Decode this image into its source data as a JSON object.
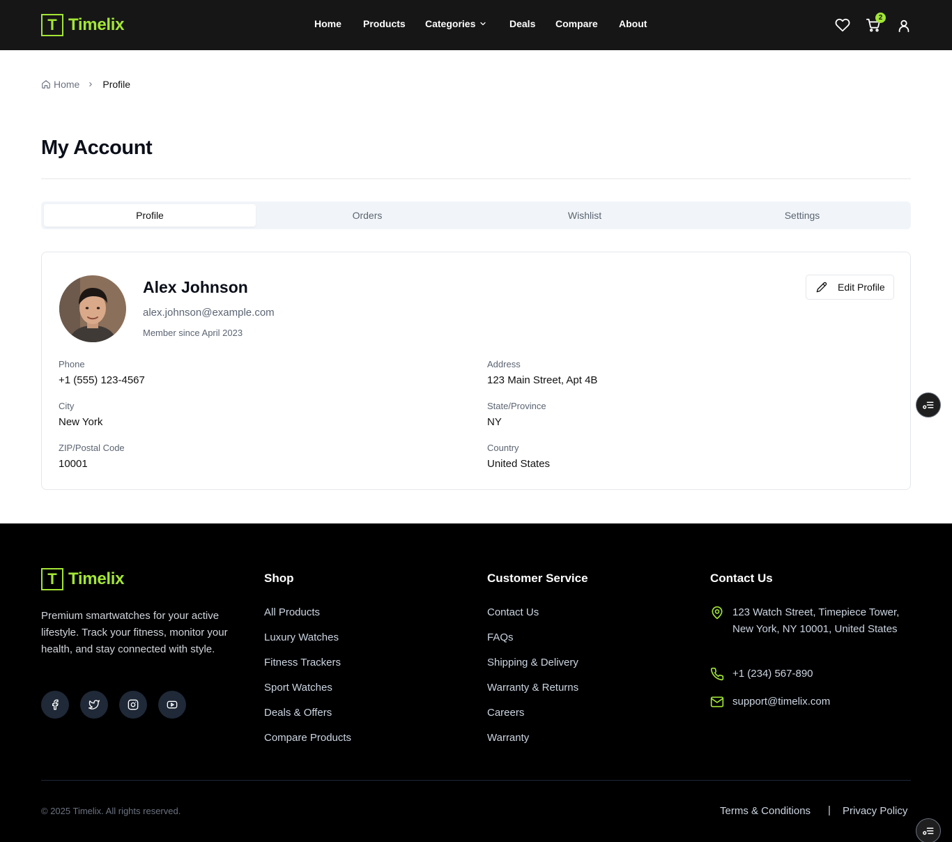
{
  "brand": {
    "mark": "T",
    "name": "Timelix",
    "accent": "#a3e635"
  },
  "nav": [
    {
      "label": "Home"
    },
    {
      "label": "Products"
    },
    {
      "label": "Categories"
    },
    {
      "label": "Deals"
    },
    {
      "label": "Compare"
    },
    {
      "label": "About"
    }
  ],
  "header_icons": {
    "wishlist": "heart-icon",
    "cart": "cart-icon",
    "account": "user-icon",
    "cart_count": "2"
  },
  "breadcrumb": {
    "home": "Home",
    "current": "Profile"
  },
  "page_title": "My Account",
  "tabs": [
    {
      "label": "Profile",
      "active": true
    },
    {
      "label": "Orders",
      "active": false
    },
    {
      "label": "Wishlist",
      "active": false
    },
    {
      "label": "Settings",
      "active": false
    }
  ],
  "profile": {
    "name": "Alex Johnson",
    "email": "alex.johnson@example.com",
    "member_since": "Member since April 2023",
    "edit_label": "Edit Profile",
    "fields": {
      "phone": {
        "label": "Phone",
        "value": "+1 (555) 123-4567"
      },
      "address": {
        "label": "Address",
        "value": "123 Main Street, Apt 4B"
      },
      "city": {
        "label": "City",
        "value": "New York"
      },
      "state": {
        "label": "State/Province",
        "value": "NY"
      },
      "zip": {
        "label": "ZIP/Postal Code",
        "value": "10001"
      },
      "country": {
        "label": "Country",
        "value": "United States"
      }
    }
  },
  "footer": {
    "description": "Premium smartwatches for your active lifestyle. Track your fitness, monitor your health, and stay connected with style.",
    "social": [
      "facebook-icon",
      "twitter-icon",
      "instagram-icon",
      "youtube-icon"
    ],
    "shop": {
      "heading": "Shop",
      "links": [
        "All Products",
        "Luxury Watches",
        "Fitness Trackers",
        "Sport Watches",
        "Deals & Offers",
        "Compare Products"
      ]
    },
    "service": {
      "heading": "Customer Service",
      "links": [
        "Contact Us",
        "FAQs",
        "Shipping & Delivery",
        "Warranty & Returns",
        "Careers",
        "Warranty"
      ]
    },
    "contact": {
      "heading": "Contact Us",
      "address": "123 Watch Street, Timepiece Tower, New York, NY 10001, United States",
      "phone": "+1 (234) 567-890",
      "email": "support@timelix.com"
    },
    "copyright": "© 2025 Timelix. All rights reserved.",
    "legal": {
      "terms": "Terms & Conditions",
      "separator": "|",
      "privacy": "Privacy Policy"
    }
  }
}
